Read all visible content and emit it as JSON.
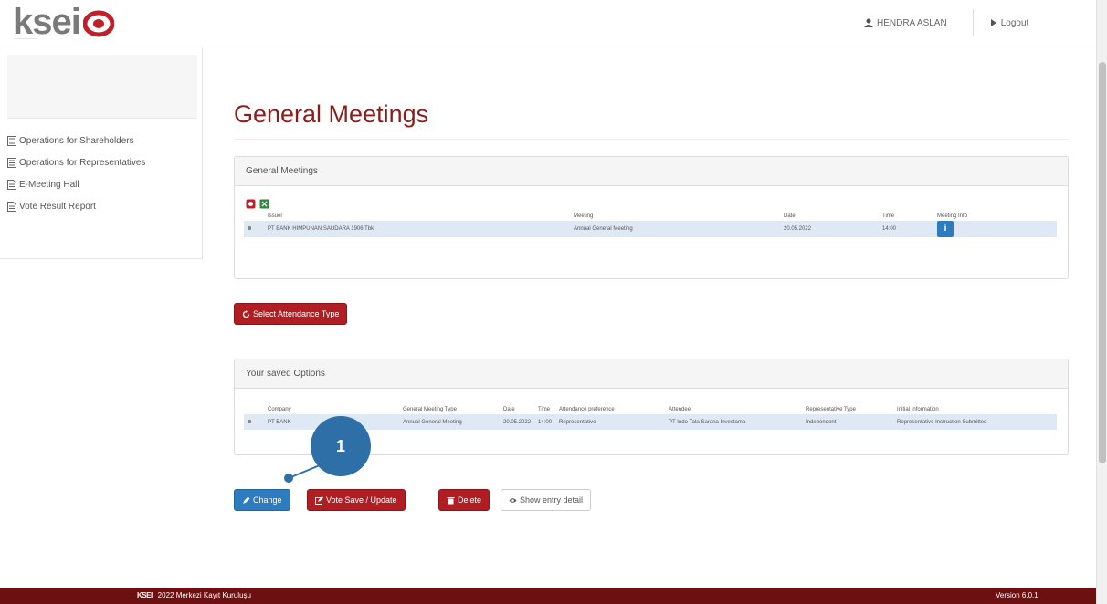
{
  "header": {
    "logo_text": "ksei",
    "user_name": "HENDRA ASLAN",
    "logout_label": "Logout"
  },
  "sidebar": {
    "items": [
      {
        "label": "Operations for Shareholders",
        "icon": "list-icon"
      },
      {
        "label": "Operations for Representatives",
        "icon": "list-icon"
      },
      {
        "label": "E-Meeting Hall",
        "icon": "document-icon"
      },
      {
        "label": "Vote Result Report",
        "icon": "document-icon"
      }
    ]
  },
  "page": {
    "title": "General Meetings"
  },
  "meetings_panel": {
    "heading": "General Meetings",
    "columns": [
      "Issuer",
      "Meeting",
      "Date",
      "Time",
      "Meeting Info"
    ],
    "rows": [
      {
        "issuer": "PT BANK HIMPUNAN SAUDARA 1906 Tbk",
        "meeting": "Annual General Meeting",
        "date": "20.05.2022",
        "time": "14:00",
        "info_icon": "i"
      }
    ]
  },
  "select_attendance_label": "Select Attendance Type",
  "saved_options_panel": {
    "heading": "Your saved Options",
    "columns": [
      "Company",
      "General Meeting Type",
      "Date",
      "Time",
      "Attendance preference",
      "Attendee",
      "Representative Type",
      "Initial Information"
    ],
    "rows": [
      {
        "company": "PT BANK",
        "type": "Annual General Meeting",
        "date": "20.05.2022",
        "time": "14:00",
        "preference": "Representative",
        "attendee": "PT Indo Tata Sarana Investama",
        "rep_type": "Independent",
        "info": "Representative Instruction Submitted"
      }
    ]
  },
  "actions": {
    "change_label": "Change",
    "vote_label": "Vote Save / Update",
    "delete_label": "Delete",
    "show_label": "Show entry detail"
  },
  "callout": {
    "number": "1",
    "color": "#2e6fa8"
  },
  "footer": {
    "logo_text": "KSEI",
    "copyright": "2022 Merkezi Kayıt Kuruluşu",
    "version": "Version 6.0.1"
  },
  "colors": {
    "brand_red": "#b01e23",
    "footer_bg": "#6d1012",
    "primary_blue": "#2f7bbf",
    "title_color": "#8b1d1d"
  }
}
